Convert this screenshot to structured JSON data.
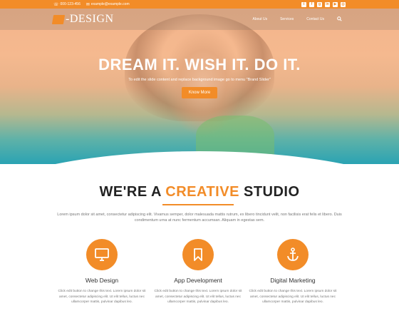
{
  "topbar": {
    "phone": "000-123-456",
    "email": "example@example.com",
    "socials": [
      "twitter-icon",
      "facebook-icon",
      "google-plus-icon",
      "linkedin-icon",
      "youtube-icon",
      "instagram-icon"
    ]
  },
  "header": {
    "logo_text": "-DESIGN",
    "nav": [
      "About Us",
      "Services",
      "Contact Us"
    ]
  },
  "hero": {
    "title": "DREAM IT. WISH IT. DO IT.",
    "subtitle": "To edit the slide content and replace background image go to menu \"Brand Slider\"",
    "button": "Know More"
  },
  "studio": {
    "pre": "WE'RE A ",
    "accent": "CREATIVE",
    "post": " STUDIO",
    "intro": "Lorem ipsum dolor sit amet, consectetur adipiscing elit. Vivamus semper, dolor malesuada mattis rutrum, ex libero tincidunt velit, non facilisis erat felis et libero. Duis condimentum urna at nunc fermentum accumsan. Aliquam in egestas sem."
  },
  "services": [
    {
      "title": "Web Design",
      "icon": "monitor-icon",
      "desc": "Click edit button to change this text. Lorem ipsum dolor sit amet, consectetur adipiscing elit. Ut elit tellus, luctus nec ullamcorper mattis, pulvinar dapibus leo."
    },
    {
      "title": "App Development",
      "icon": "bookmark-icon",
      "desc": "Click edit button to change this text. Lorem ipsum dolor sit amet, consectetur adipiscing elit. Ut elit tellus, luctus nec ullamcorper mattis, pulvinar dapibus leo."
    },
    {
      "title": "Digital Marketing",
      "icon": "anchor-icon",
      "desc": "Click edit button to change this text. Lorem ipsum dolor sit amet, consectetur adipiscing elit. Ut elit tellus, luctus nec ullamcorper mattis, pulvinar dapibus leo."
    }
  ],
  "colors": {
    "accent": "#f28c28"
  }
}
